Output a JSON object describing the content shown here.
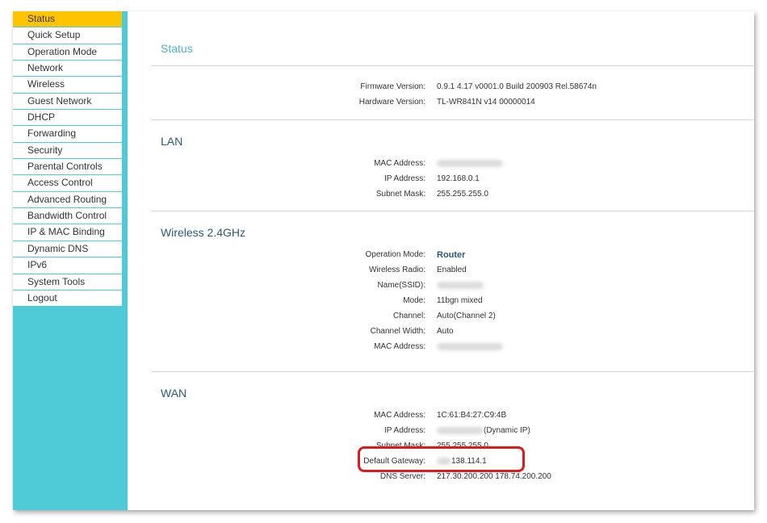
{
  "sidebar": {
    "items": [
      {
        "label": "Status",
        "active": true
      },
      {
        "label": "Quick Setup"
      },
      {
        "label": "Operation Mode"
      },
      {
        "label": "Network"
      },
      {
        "label": "Wireless"
      },
      {
        "label": "Guest Network"
      },
      {
        "label": "DHCP"
      },
      {
        "label": "Forwarding"
      },
      {
        "label": "Security"
      },
      {
        "label": "Parental Controls"
      },
      {
        "label": "Access Control"
      },
      {
        "label": "Advanced Routing"
      },
      {
        "label": "Bandwidth Control"
      },
      {
        "label": "IP & MAC Binding"
      },
      {
        "label": "Dynamic DNS"
      },
      {
        "label": "IPv6"
      },
      {
        "label": "System Tools"
      },
      {
        "label": "Logout"
      }
    ]
  },
  "status": {
    "title": "Status",
    "firmware_label": "Firmware Version:",
    "firmware_value": "0.9.1 4.17 v0001.0 Build 200903 Rel.58674n",
    "hardware_label": "Hardware Version:",
    "hardware_value": "TL-WR841N v14 00000014"
  },
  "lan": {
    "title": "LAN",
    "mac_label": "MAC Address:",
    "ip_label": "IP Address:",
    "ip_value": "192.168.0.1",
    "mask_label": "Subnet Mask:",
    "mask_value": "255.255.255.0"
  },
  "wireless": {
    "title": "Wireless 2.4GHz",
    "opmode_label": "Operation Mode:",
    "opmode_value": "Router",
    "radio_label": "Wireless Radio:",
    "radio_value": "Enabled",
    "ssid_label": "Name(SSID):",
    "mode_label": "Mode:",
    "mode_value": "11bgn mixed",
    "channel_label": "Channel:",
    "channel_value": "Auto(Channel 2)",
    "width_label": "Channel Width:",
    "width_value": "Auto",
    "mac_label": "MAC Address:"
  },
  "wan": {
    "title": "WAN",
    "mac_label": "MAC Address:",
    "mac_value": "1C:61:B4:27:C9:4B",
    "ip_label": "IP Address:",
    "ip_suffix": "(Dynamic IP)",
    "mask_label": "Subnet Mask:",
    "mask_value": "255.255.255.0",
    "gateway_label": "Default Gateway:",
    "gateway_value": "138.114.1",
    "dns_label": "DNS Server:",
    "dns_value": "217.30.200.200 178.74.200.200"
  }
}
